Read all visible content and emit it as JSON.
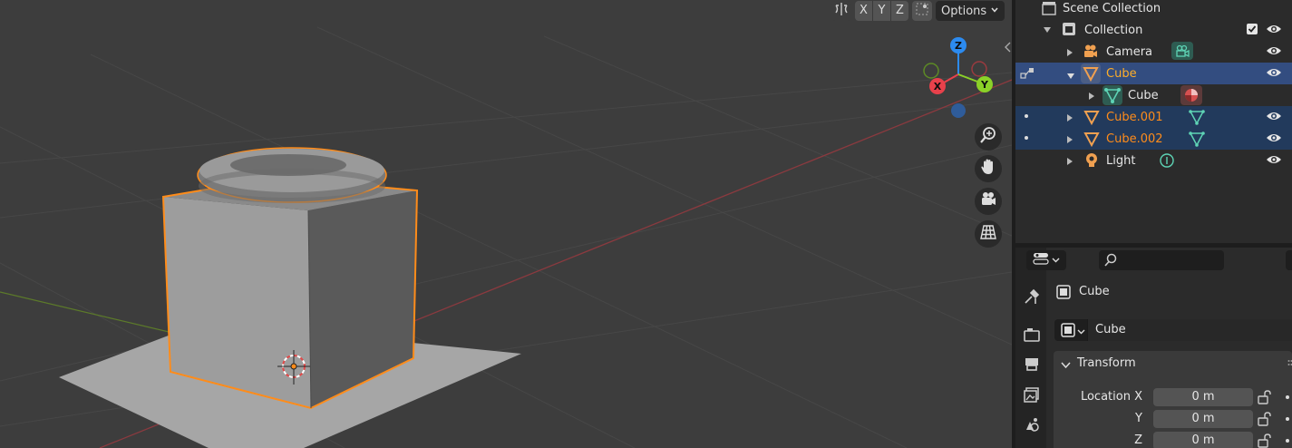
{
  "viewport": {
    "header": {
      "axes": [
        "X",
        "Y",
        "Z"
      ],
      "options_label": "Options",
      "icons": [
        "mirror-icon",
        "snap-grid-icon",
        "chevron-down-icon"
      ]
    },
    "gizmo": {
      "z_label": "Z",
      "x_label": "X",
      "y_label": "Y"
    },
    "nav_icons": [
      "zoom-icon",
      "hand-icon",
      "camera-icon",
      "grid-icon"
    ]
  },
  "outliner": {
    "scene_collection": "Scene Collection",
    "collection": "Collection",
    "items": [
      {
        "label": "Camera",
        "icon": "camera-object-icon",
        "data_icon": "camera-data-icon",
        "selected": false
      },
      {
        "label": "Cube",
        "icon": "mesh-object-icon",
        "selected": true,
        "active": true
      },
      {
        "label": "Cube",
        "icon": "mesh-data-icon",
        "data_icon": "material-icon",
        "child": true
      },
      {
        "label": "Cube.001",
        "icon": "mesh-object-icon",
        "data_icon": "mesh-data-icon",
        "selected": true
      },
      {
        "label": "Cube.002",
        "icon": "mesh-object-icon",
        "data_icon": "mesh-data-icon",
        "selected": true
      },
      {
        "label": "Light",
        "icon": "light-object-icon",
        "data_icon": "light-data-icon",
        "selected": false
      }
    ]
  },
  "properties": {
    "search_placeholder": "",
    "object_name": "Cube",
    "datablock_name": "Cube",
    "panel_title": "Transform",
    "location": {
      "label_x": "Location X",
      "label_y": "Y",
      "label_z": "Z",
      "x": "0 m",
      "y": "0 m",
      "z": "0 m"
    }
  },
  "colors": {
    "selection_orange": "#ff8c1a",
    "active_row": "#334d80",
    "selected_row": "#223a5c",
    "axis_x": "#e8414b",
    "axis_y": "#8bd128",
    "axis_z": "#2c8bf0"
  }
}
